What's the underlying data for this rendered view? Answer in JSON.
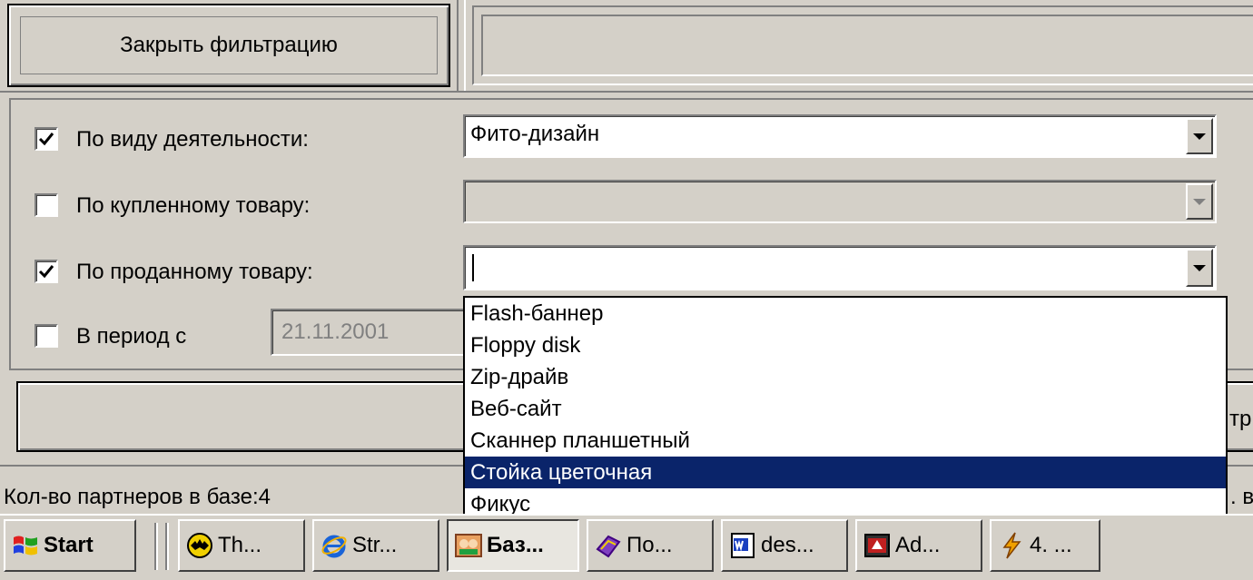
{
  "toolbar": {
    "close_filter_label": "Закрыть фильтрацию"
  },
  "filters": {
    "activity": {
      "label": "По виду деятельности:",
      "checked": true,
      "value": "Фито-дизайн"
    },
    "bought": {
      "label": "По купленному товару:",
      "checked": false,
      "value": ""
    },
    "sold": {
      "label": "По проданному товару:",
      "checked": true,
      "value": ""
    },
    "period": {
      "label": "В период с",
      "checked": false,
      "date_from": "21.11.2001"
    }
  },
  "dropdown": {
    "items": [
      "Flash-баннер",
      "Floppy disk",
      "Zip-драйв",
      "Веб-сайт",
      "Сканнер планшетный",
      "Стойка цветочная",
      "Фикус"
    ],
    "selected_index": 5
  },
  "partial": {
    "right_edge_text": "тр",
    "status_right": ". в"
  },
  "status": {
    "partners_count": "Кол-во партнеров в базе:4"
  },
  "taskbar": {
    "start_label": "Start",
    "tasks": [
      {
        "label": "Th...",
        "icon": "bat-icon"
      },
      {
        "label": "Str...",
        "icon": "ie-icon"
      },
      {
        "label": "Баз...",
        "icon": "database-app-icon",
        "active": true
      },
      {
        "label": "По...",
        "icon": "book-icon"
      },
      {
        "label": "des...",
        "icon": "word-icon"
      },
      {
        "label": "Ad...",
        "icon": "acrobat-icon"
      },
      {
        "label": "4. ...",
        "icon": "lightning-icon"
      }
    ]
  },
  "colors": {
    "face": "#d4d0c8",
    "selection": "#0a246a"
  }
}
